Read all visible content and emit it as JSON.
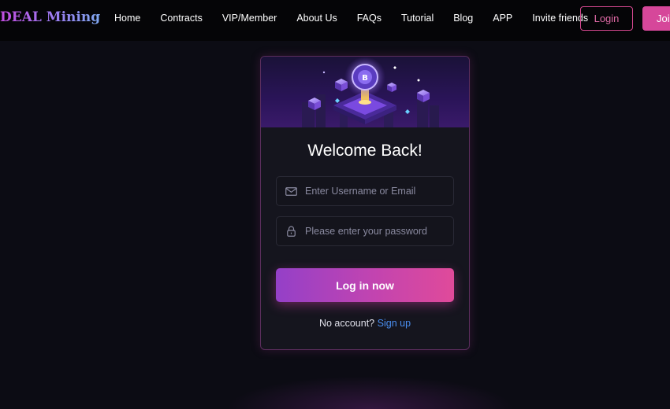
{
  "header": {
    "logo_text": "DEAL Mining",
    "nav": [
      {
        "label": "Home"
      },
      {
        "label": "Contracts"
      },
      {
        "label": "VIP/Member"
      },
      {
        "label": "About Us"
      },
      {
        "label": "FAQs"
      },
      {
        "label": "Tutorial"
      },
      {
        "label": "Blog"
      },
      {
        "label": "APP"
      },
      {
        "label": "Invite friends"
      }
    ],
    "login_label": "Login",
    "join_label": "Join"
  },
  "login_card": {
    "banner_icon": "crypto-mining-isometric-illustration",
    "title": "Welcome Back!",
    "username": {
      "placeholder": "Enter Username or Email",
      "value": "",
      "icon": "mail-icon"
    },
    "password": {
      "placeholder": "Please enter your password",
      "value": "",
      "icon": "lock-icon"
    },
    "submit_label": "Log in now",
    "no_account_text": "No account?",
    "signup_label": "Sign up"
  },
  "colors": {
    "accent_pink": "#d6479a",
    "link_blue": "#4a8ef0",
    "background": "#0c0c14"
  }
}
